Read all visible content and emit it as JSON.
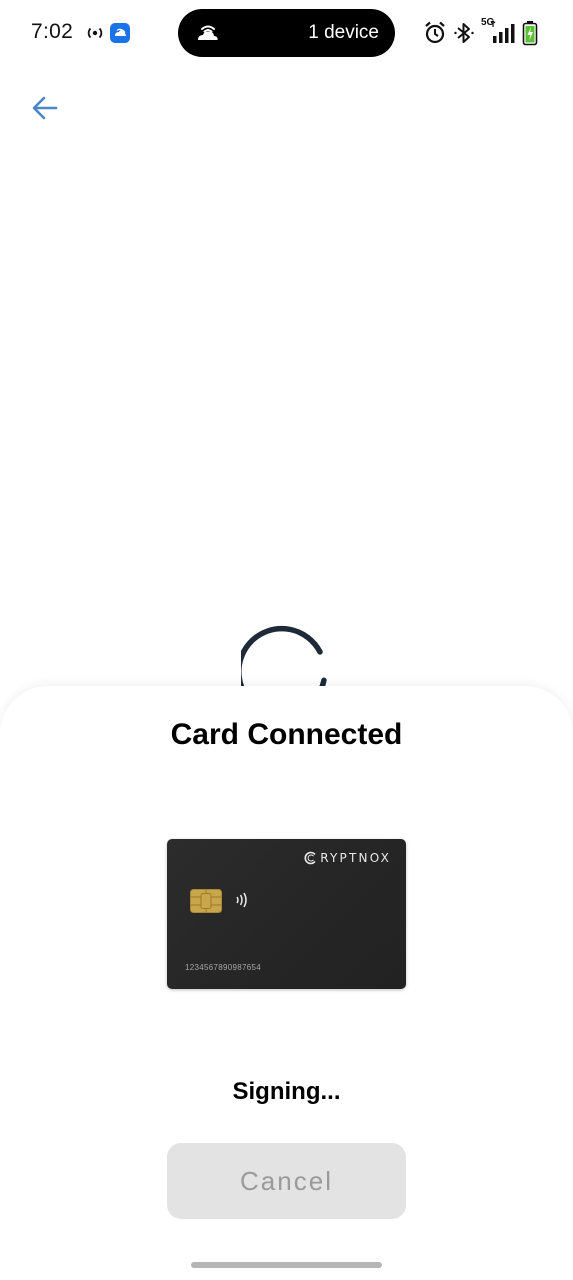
{
  "status_bar": {
    "time": "7:02",
    "hotspot_label": "(o)",
    "pill_text": "1 device",
    "network_type": "5G",
    "icons": {
      "hotspot": "hotspot-icon",
      "app": "cloud-app-icon",
      "pill": "cloud-wifi-icon",
      "alarm": "alarm-icon",
      "bluetooth": "bluetooth-icon",
      "signal": "signal-icon",
      "battery": "battery-charging-icon"
    }
  },
  "header": {
    "back_icon": "arrow-left-icon",
    "back_color": "#4a86c8"
  },
  "loading": {
    "spinner_icon": "loading-spinner-icon",
    "spinner_color": "#1e2a38"
  },
  "sheet": {
    "title": "Card Connected",
    "card": {
      "brand": "RYPTNOX",
      "number": "1234567890987654",
      "chip_icon": "chip-icon",
      "contactless_icon": "contactless-icon",
      "card_color": "#252525",
      "chip_color": "#c9a64a"
    },
    "status_text": "Signing...",
    "cancel_label": "Cancel",
    "cancel_bg": "#e3e3e3",
    "cancel_text_color": "#9a9a9a"
  }
}
